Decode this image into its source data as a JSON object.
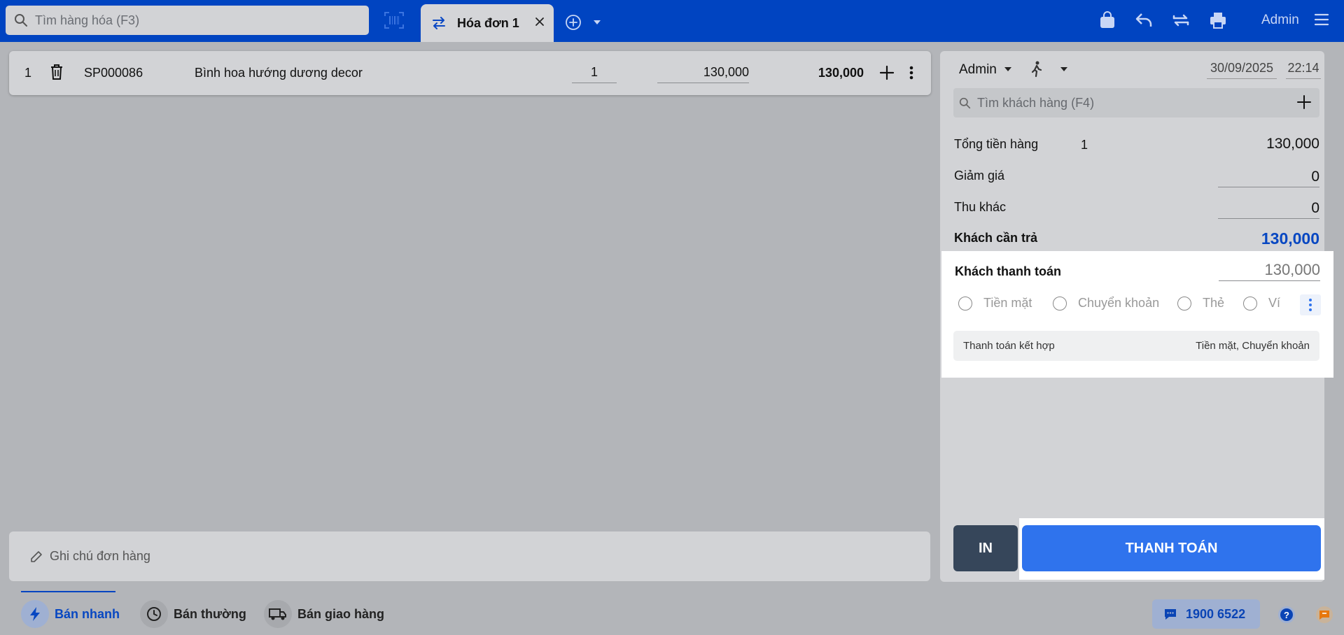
{
  "header": {
    "search_placeholder": "Tìm hàng hóa (F3)",
    "tab_label": "Hóa đơn 1",
    "user": "Admin"
  },
  "cart": {
    "items": [
      {
        "index": "1",
        "code": "SP000086",
        "name": "Bình hoa hướng dương decor",
        "qty": "1",
        "price": "130,000",
        "total": "130,000"
      }
    ]
  },
  "order_note_placeholder": "Ghi chú đơn hàng",
  "sidebar": {
    "seller": "Admin",
    "date": "30/09/2025",
    "time": "22:14",
    "customer_search_placeholder": "Tìm khách hàng (F4)",
    "subtotal_label": "Tổng tiền hàng",
    "subtotal_count": "1",
    "subtotal_value": "130,000",
    "discount_label": "Giảm giá",
    "discount_value": "0",
    "other_fee_label": "Thu khác",
    "other_fee_value": "0",
    "due_label": "Khách cần trả",
    "due_value": "130,000",
    "paid_label": "Khách thanh toán",
    "paid_value": "130,000",
    "methods": [
      "Tiền mặt",
      "Chuyển khoản",
      "Thẻ",
      "Ví"
    ],
    "combined_label": "Thanh toán kết hợp",
    "combined_value": "Tiền mặt, Chuyển khoản",
    "print_label": "IN",
    "pay_label": "THANH TOÁN"
  },
  "footer": {
    "modes": [
      "Bán nhanh",
      "Bán thường",
      "Bán giao hàng"
    ],
    "active_mode": "Bán nhanh",
    "hotline": "1900 6522"
  },
  "colors": {
    "brand": "#0044c1",
    "pay_button": "#2f73ed",
    "due_value": "#0747c2",
    "print_button": "#36465a"
  }
}
